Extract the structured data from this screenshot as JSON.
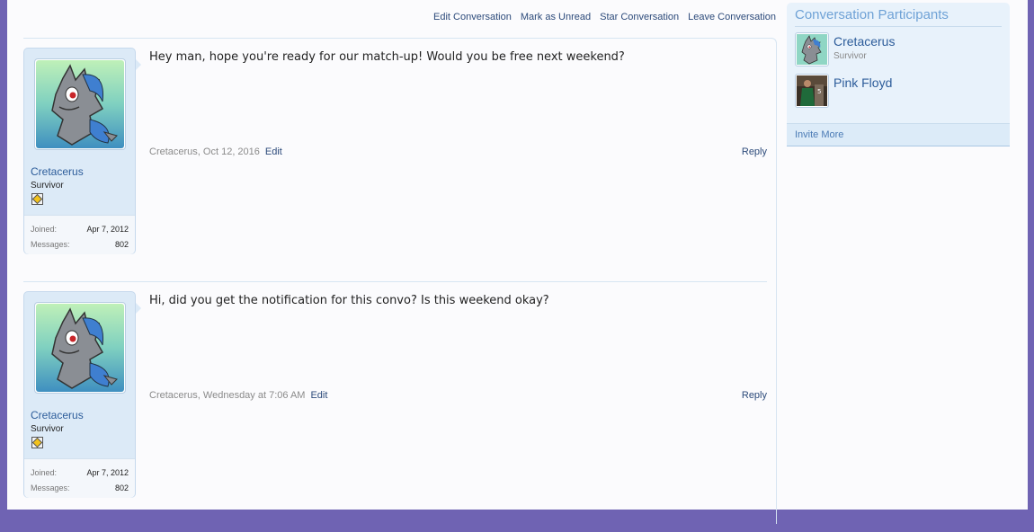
{
  "actions": {
    "edit": "Edit Conversation",
    "mark_unread": "Mark as Unread",
    "star": "Star Conversation",
    "leave": "Leave Conversation"
  },
  "messages": [
    {
      "username": "Cretacerus",
      "user_title": "Survivor",
      "joined_label": "Joined:",
      "joined": "Apr 7, 2012",
      "messages_label": "Messages:",
      "message_count": "802",
      "text": "Hey man, hope you're ready for our match-up! Would you be free next weekend?",
      "meta": "Cretacerus, Oct 12, 2016",
      "edit_label": "Edit",
      "reply_label": "Reply"
    },
    {
      "username": "Cretacerus",
      "user_title": "Survivor",
      "joined_label": "Joined:",
      "joined": "Apr 7, 2012",
      "messages_label": "Messages:",
      "message_count": "802",
      "text": "Hi, did you get the notification for this convo? Is this weekend okay?",
      "meta": "Cretacerus, Wednesday at 7:06 AM",
      "edit_label": "Edit",
      "reply_label": "Reply"
    }
  ],
  "sidebar": {
    "title": "Conversation Participants",
    "participants": [
      {
        "name": "Cretacerus",
        "title": "Survivor"
      },
      {
        "name": "Pink Floyd",
        "title": ""
      }
    ],
    "invite_label": "Invite More"
  }
}
